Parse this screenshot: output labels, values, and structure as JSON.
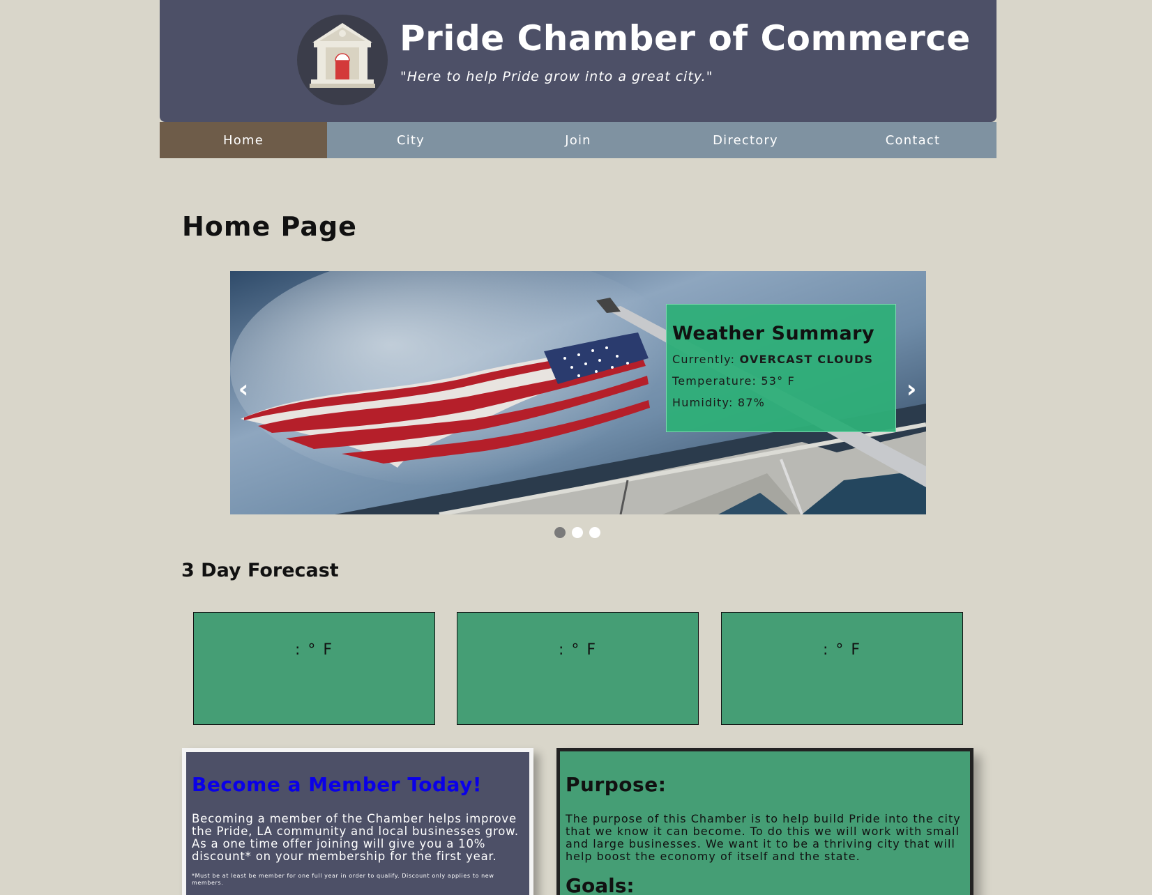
{
  "header": {
    "title": "Pride Chamber of Commerce",
    "tagline": "\"Here to help Pride grow into a great city.\""
  },
  "nav": {
    "items": [
      "Home",
      "City",
      "Join",
      "Directory",
      "Contact"
    ],
    "active": "Home"
  },
  "main": {
    "page_title": "Home Page",
    "slideshow": {
      "prev_label": "‹",
      "next_label": "›",
      "active_dot": 1,
      "dot_count": 3
    },
    "weather": {
      "title": "Weather Summary",
      "currently_label": "Currently:",
      "currently_value": "OVERCAST CLOUDS",
      "temperature": "Temperature: 53° F",
      "humidity": "Humidity: 87%"
    },
    "forecast": {
      "title": "3 Day Forecast",
      "days": [
        ": ° F",
        ": ° F",
        ": ° F"
      ]
    },
    "member": {
      "title": "Become a Member Today!",
      "body": "Becoming a member of the Chamber helps improve the Pride, LA community and local businesses grow. As a one time offer joining will give you a 10% discount* on your membership for the first year.",
      "fine_print": "*Must be at least be member for one full year in order to qualify. Discount only applies to new members."
    },
    "purpose": {
      "title": "Purpose:",
      "body": "The purpose of this Chamber is to help build Pride into the city that we know it can become. To do this we will work with small and large businesses. We want it to be a thriving city that will help boost the economy of itself and the state.",
      "goals_title": "Goals:"
    }
  },
  "colors": {
    "header_bg": "#4d5067",
    "nav_bg": "#7f92a1",
    "nav_active": "#6e5c49",
    "page_bg": "#d9d6ca",
    "card_green": "#459e75",
    "member_title": "#0a00e8"
  }
}
